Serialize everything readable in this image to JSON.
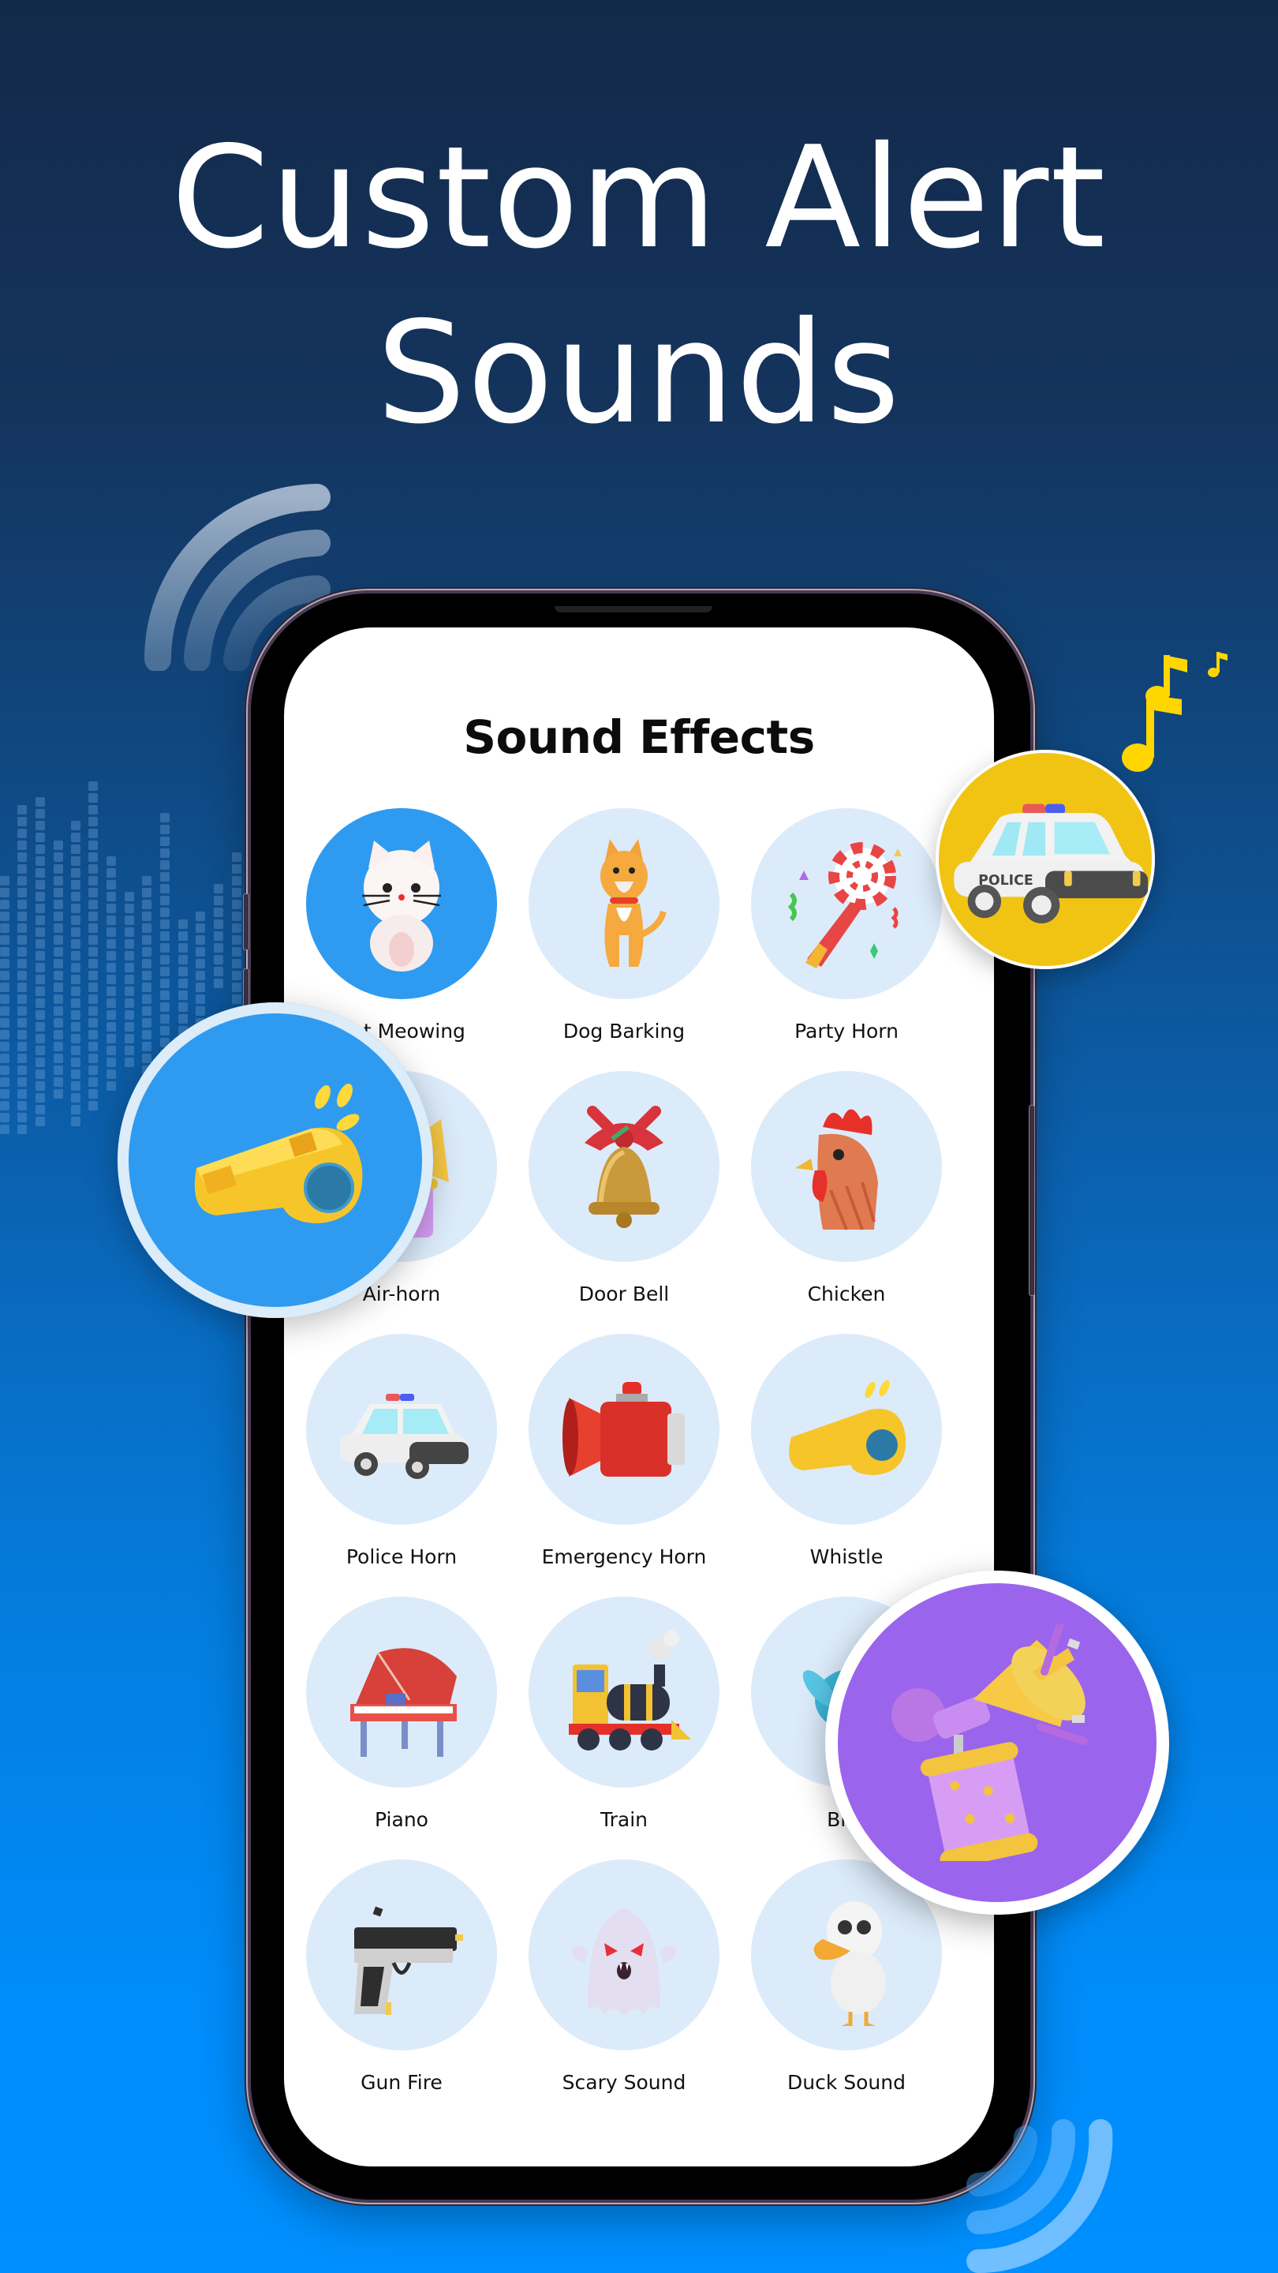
{
  "headline": {
    "line1": "Custom Alert",
    "line2": "Sounds"
  },
  "screen": {
    "title": "Sound Effects",
    "selected_index": 0,
    "items": [
      {
        "label": "Cat Meowing",
        "icon": "cat-icon"
      },
      {
        "label": "Dog Barking",
        "icon": "dog-icon"
      },
      {
        "label": "Party Horn",
        "icon": "party-horn-icon"
      },
      {
        "label": "Air-horn",
        "icon": "air-horn-icon"
      },
      {
        "label": "Door Bell",
        "icon": "door-bell-icon"
      },
      {
        "label": "Chicken",
        "icon": "chicken-icon"
      },
      {
        "label": "Police Horn",
        "icon": "police-car-icon"
      },
      {
        "label": "Emergency Horn",
        "icon": "emergency-siren-icon"
      },
      {
        "label": "Whistle",
        "icon": "whistle-icon"
      },
      {
        "label": "Piano",
        "icon": "piano-icon"
      },
      {
        "label": "Train",
        "icon": "train-icon"
      },
      {
        "label": "Bird",
        "icon": "bird-icon"
      },
      {
        "label": "Gun Fire",
        "icon": "gun-icon"
      },
      {
        "label": "Scary Sound",
        "icon": "ghost-icon"
      },
      {
        "label": "Duck Sound",
        "icon": "duck-icon"
      }
    ]
  },
  "badges": {
    "left": {
      "icon": "whistle-icon"
    },
    "top_right": {
      "icon": "police-car-icon",
      "car_text": "POLICE"
    },
    "bottom_right": {
      "icon": "air-horn-icon"
    }
  },
  "colors": {
    "selected_circle": "#2f9bf0",
    "item_circle": "#dcebfa",
    "police_badge": "#f1c414",
    "airhorn_badge": "#9b64ec",
    "music_note": "#ffd600"
  }
}
